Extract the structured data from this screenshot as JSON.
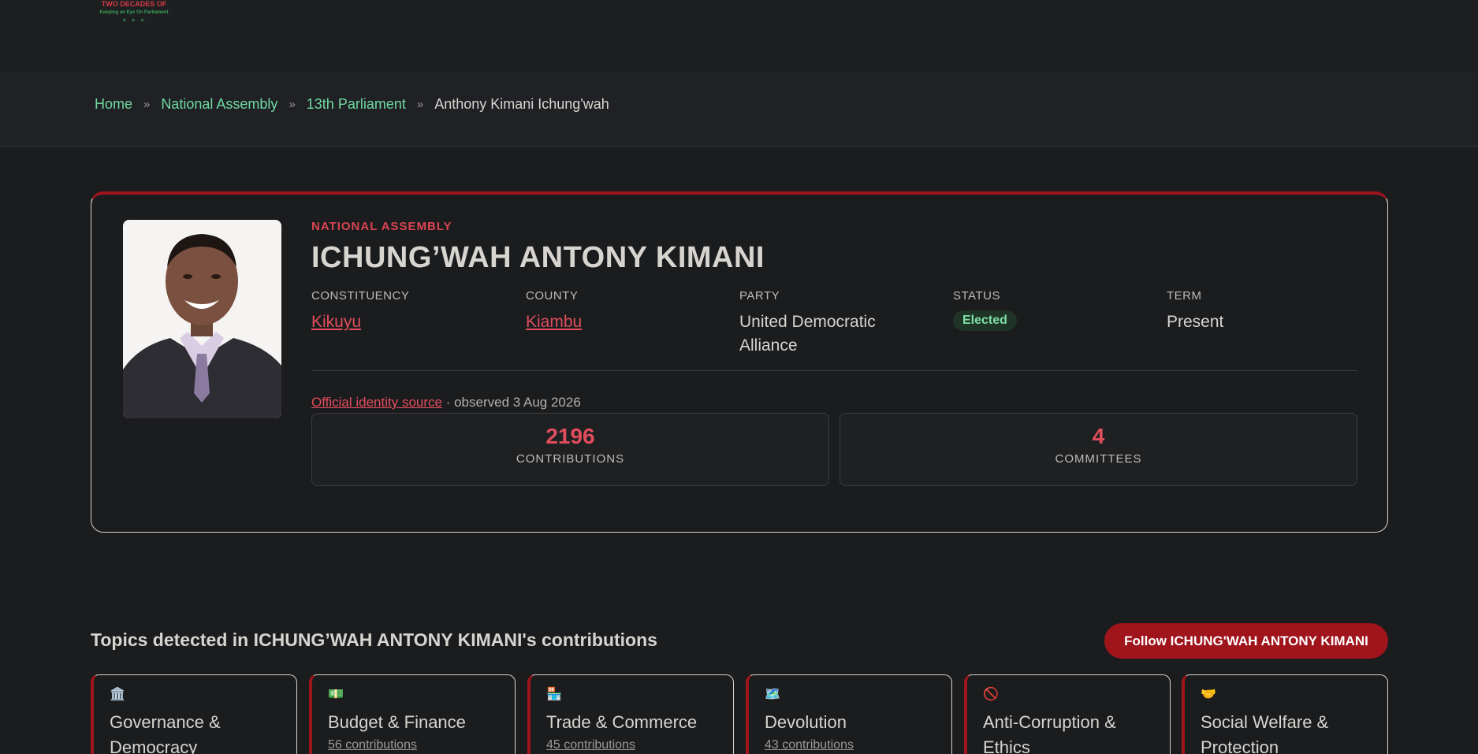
{
  "logo": {
    "line1": "TWO DECADES OF",
    "line2": "Keeping an Eye On Parliament",
    "stars": "* * *"
  },
  "breadcrumb": {
    "items": [
      {
        "label": "Home"
      },
      {
        "label": "National Assembly"
      },
      {
        "label": "13th Parliament"
      }
    ],
    "current": "Anthony Kimani Ichung'wah",
    "separator": "»"
  },
  "profile": {
    "house": "NATIONAL ASSEMBLY",
    "name": "ICHUNG’WAH ANTONY KIMANI",
    "facts": {
      "constituency": {
        "label": "CONSTITUENCY",
        "value": "Kikuyu"
      },
      "county": {
        "label": "COUNTY",
        "value": "Kiambu"
      },
      "party": {
        "label": "PARTY",
        "value": "United Democratic Alliance"
      },
      "status": {
        "label": "STATUS",
        "value": "Elected"
      },
      "term": {
        "label": "TERM",
        "value": "Present"
      }
    },
    "source_link": "Official identity source",
    "observed": " · observed 3 Aug 2026",
    "stats": {
      "contributions": {
        "value": "2196",
        "label": "CONTRIBUTIONS"
      },
      "committees": {
        "value": "4",
        "label": "COMMITTEES"
      }
    }
  },
  "topics": {
    "title": "Topics detected in ICHUNG’WAH ANTONY KIMANI's contributions",
    "follow_label": "Follow ICHUNG'WAH ANTONY KIMANI",
    "cards": [
      {
        "icon": "🏛️",
        "title": "Governance & Democracy",
        "count": ""
      },
      {
        "icon": "💵",
        "title": "Budget & Finance",
        "count": "56 contributions"
      },
      {
        "icon": "🏪",
        "title": "Trade & Commerce",
        "count": "45 contributions"
      },
      {
        "icon": "🗺️",
        "title": "Devolution",
        "count": "43 contributions"
      },
      {
        "icon": "🚫",
        "title": "Anti-Corruption & Ethics",
        "count": ""
      },
      {
        "icon": "🤝",
        "title": "Social Welfare & Protection",
        "count": ""
      }
    ]
  },
  "colors": {
    "accent": "#a0141c",
    "link": "#e24d5c",
    "crumb": "#6fd9a1",
    "status": "#7fe0a6"
  }
}
